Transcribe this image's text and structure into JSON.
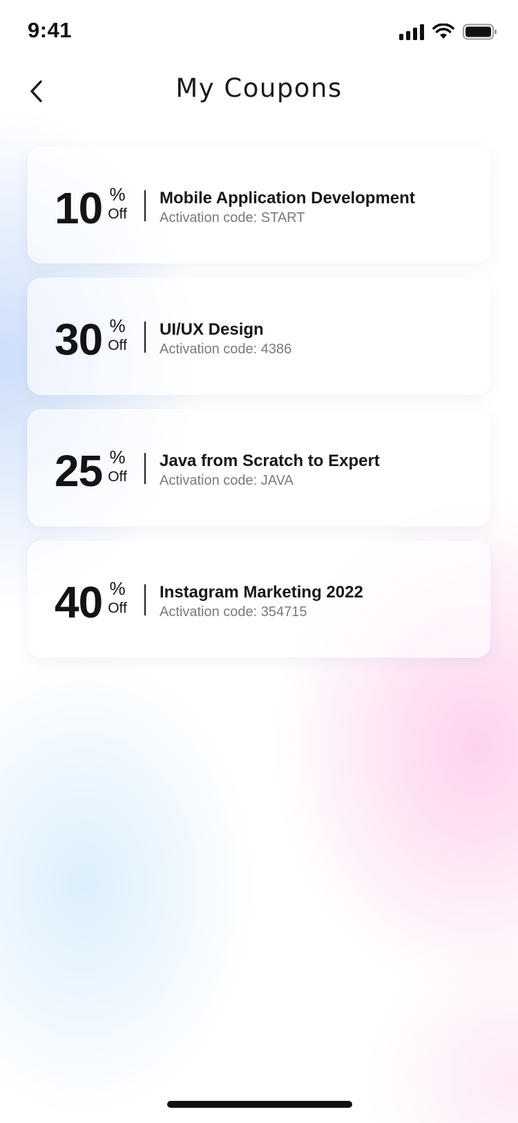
{
  "status_bar": {
    "time": "9:41",
    "icons": [
      "signal-icon",
      "wifi-icon",
      "battery-icon"
    ]
  },
  "header": {
    "back_icon": "chevron-left-icon",
    "title": "My Coupons"
  },
  "coupons": [
    {
      "discount": "10",
      "percent_sign": "%",
      "off_label": "Off",
      "title": "Mobile Application Development",
      "code_label": "Activation code:",
      "code": "START"
    },
    {
      "discount": "30",
      "percent_sign": "%",
      "off_label": "Off",
      "title": "UI/UX Design",
      "code_label": "Activation code:",
      "code": "4386"
    },
    {
      "discount": "25",
      "percent_sign": "%",
      "off_label": "Off",
      "title": "Java from Scratch to Expert",
      "code_label": "Activation code:",
      "code": "JAVA"
    },
    {
      "discount": "40",
      "percent_sign": "%",
      "off_label": "Off",
      "title": "Instagram Marketing 2022",
      "code_label": "Activation code:",
      "code": "354715"
    }
  ],
  "colors": {
    "text_primary": "#141414",
    "text_secondary": "#7a7a7a",
    "bg_blue": "#c4d8f8",
    "bg_pink": "#fdcdec"
  }
}
